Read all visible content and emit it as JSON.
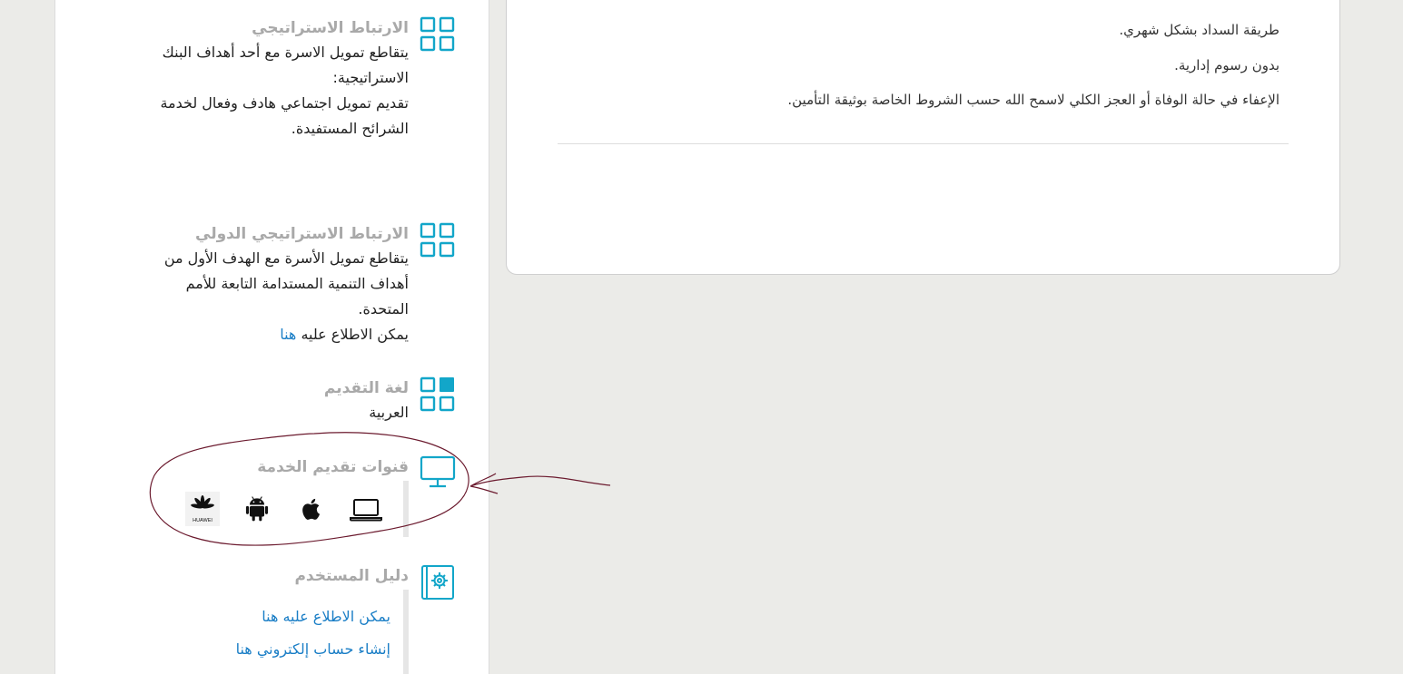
{
  "sidebar": {
    "strategic_link": {
      "title": "الارتباط الاستراتيجي",
      "lines": [
        "يتقاطع تمويل الاسرة مع أحد أهداف البنك",
        "الاستراتيجية:",
        "تقديم تمويل اجتماعي هادف وفعال لخدمة",
        "الشرائح المستفيدة."
      ]
    },
    "intl_link": {
      "title": "الارتباط الاستراتيجي الدولي",
      "lines": [
        "يتقاطع تمويل الأسرة مع الهدف الأول من",
        "أهداف التنمية المستدامة التابعة للأمم",
        "المتحدة."
      ],
      "view_prefix": "يمكن الاطلاع عليه",
      "view_link": "هنا"
    },
    "language": {
      "title": "لغة التقديم",
      "value": "العربية"
    },
    "channels": {
      "title": "قنوات تقديم الخدمة",
      "items": [
        "laptop-icon",
        "apple-icon",
        "android-icon",
        "huawei-icon"
      ],
      "huawei_label": "HUAWEI"
    },
    "guide": {
      "title": "دليل المستخدم",
      "links": [
        "يمكن الاطلاع عليه هنا",
        "إنشاء حساب إلكتروني هنا"
      ]
    }
  },
  "card": {
    "lines": [
      "طريقة السداد بشكل شهري.",
      "بدون رسوم إدارية.",
      "الإعفاء في حالة الوفاة أو العجز الكلي لاسمح الله حسب الشروط الخاصة بوثيقة التأمين."
    ]
  },
  "colors": {
    "accent": "#12a6c9",
    "link": "#1a7ec6",
    "annotation": "#6b1a2e",
    "muted_title": "#a9a9a9"
  }
}
